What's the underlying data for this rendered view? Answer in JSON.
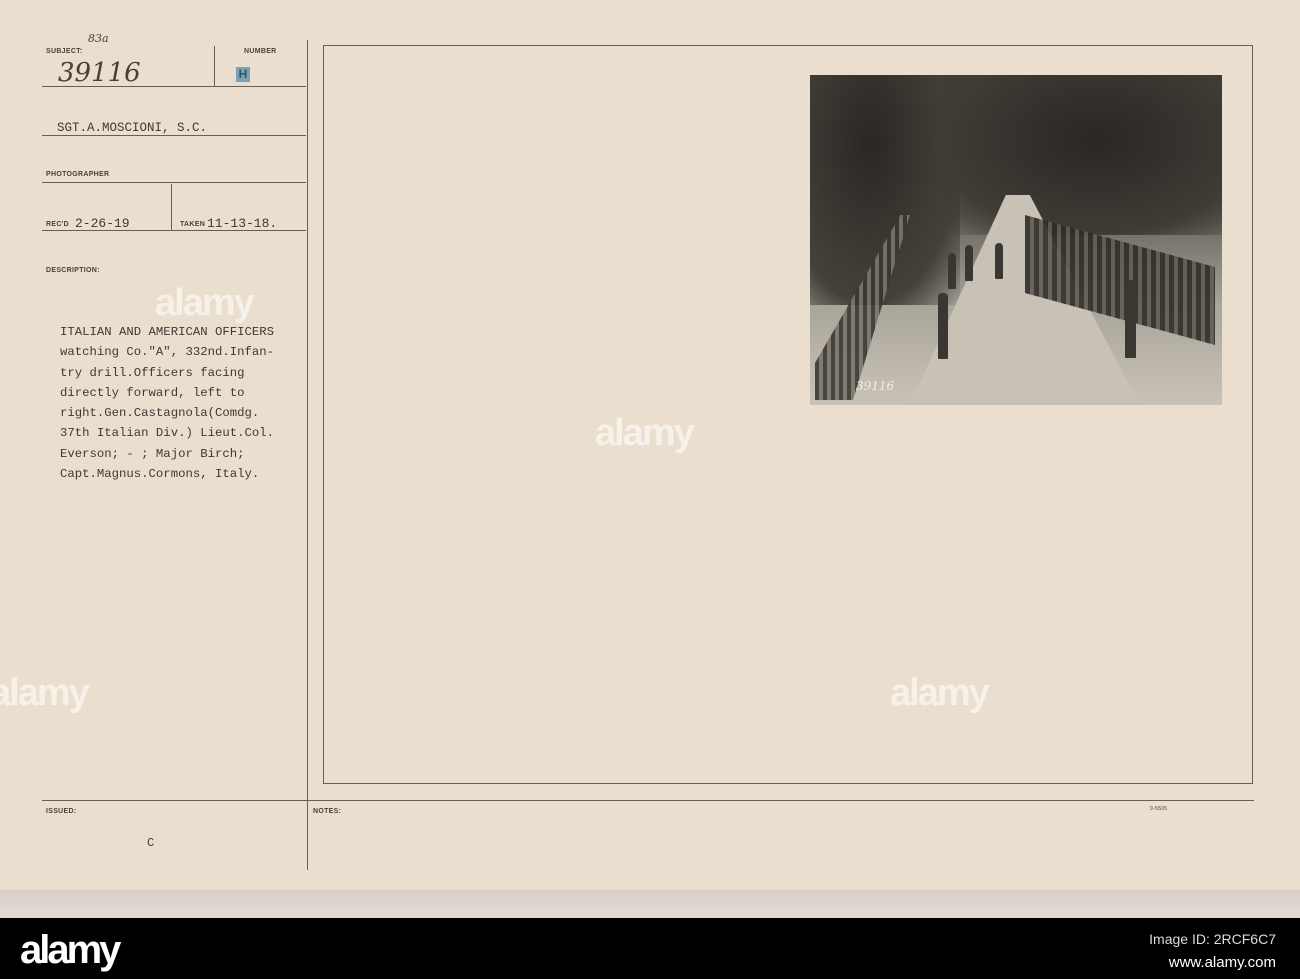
{
  "card": {
    "subject_label": "SUBJECT:",
    "subject_annotation": "83a",
    "subject_number": "39116",
    "number_label": "NUMBER",
    "number_stamp": "H",
    "photographer_value": "SGT.A.MOSCIONI, S.C.",
    "photographer_label": "PHOTOGRAPHER",
    "recd_label": "REC'D",
    "recd_value": "2-26-19",
    "taken_label": "TAKEN",
    "taken_value": "11-13-18.",
    "description_label": "DESCRIPTION:",
    "description_lines": [
      "ITALIAN AND AMERICAN OFFICERS",
      "watching Co.\"A\", 332nd.Infan-",
      "try drill.Officers facing",
      "directly forward, left to",
      "right.Gen.Castagnola(Comdg.",
      "37th Italian Div.) Lieut.Col.",
      "Everson; - ; Major Birch;",
      "Capt.Magnus.Cormons, Italy."
    ],
    "issued_label": "ISSUED:",
    "issued_value": "C",
    "notes_label": "NOTES:",
    "form_code": "9-5505",
    "photo_number": "39116"
  },
  "watermark": "alamy",
  "footer": {
    "brand": "alamy",
    "image_id": "Image ID: 2RCF6C7",
    "url": "www.alamy.com"
  }
}
